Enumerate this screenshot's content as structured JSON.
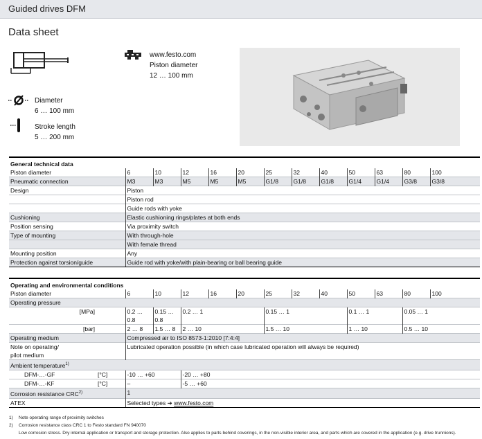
{
  "header": {
    "title": "Guided drives DFM"
  },
  "page_title": "Data sheet",
  "product_data": {
    "website": "www.festo.com",
    "label": "Piston diameter",
    "range": "12 … 100 mm"
  },
  "features": [
    {
      "icon": "diameter-icon",
      "label": "Diameter",
      "value": "6 … 100 mm"
    },
    {
      "icon": "stroke-length-icon",
      "label": "Stroke length",
      "value": "5 … 200 mm"
    }
  ],
  "diameters": [
    "6",
    "10",
    "12",
    "16",
    "20",
    "25",
    "32",
    "40",
    "50",
    "63",
    "80",
    "100"
  ],
  "general": {
    "title": "General technical data",
    "piston_label": "Piston diameter",
    "pneumatic": {
      "label": "Pneumatic connection",
      "values": [
        "M3",
        "M3",
        "M5",
        "M5",
        "M5",
        "G1/8",
        "G1/8",
        "G1/8",
        "G1/4",
        "G1/4",
        "G3/8",
        "G3/8"
      ]
    },
    "design": {
      "label": "Design",
      "values": [
        "Piston",
        "Piston rod",
        "Guide rods with yoke"
      ]
    },
    "cushioning": {
      "label": "Cushioning",
      "value": "Elastic cushioning rings/plates at both ends"
    },
    "position_sensing": {
      "label": "Position sensing",
      "value": "Via proximity switch"
    },
    "mounting": {
      "label": "Type of mounting",
      "values": [
        "With through-hole",
        "With female thread"
      ]
    },
    "mounting_position": {
      "label": "Mounting position",
      "value": "Any"
    },
    "torsion": {
      "label": "Protection against torsion/guide",
      "value": "Guide rod with yoke/with plain-bearing or ball bearing guide"
    }
  },
  "operating": {
    "title": "Operating and environmental conditions",
    "piston_label": "Piston diameter",
    "pressure_label": "Operating pressure",
    "mpa_unit": "[MPa]",
    "bar_unit": "[bar]",
    "mpa": {
      "a1": "0.2 …",
      "a2": "0.8",
      "b1": "0.15 …",
      "b2": "0.8",
      "c": "0.2 … 1",
      "d": "0.15 … 1",
      "e": "0.1 … 1",
      "f": "0.05 … 1"
    },
    "bar": {
      "a": "2 … 8",
      "b": "1.5 … 8",
      "c": "2 … 10",
      "d": "1.5 … 10",
      "e": "1 … 10",
      "f": "0.5 … 10"
    },
    "medium": {
      "label": "Operating medium",
      "value": "Compressed air to ISO 8573-1:2010 [7:4:4]"
    },
    "note": {
      "label1": "Note on operating/",
      "label2": "pilot medium",
      "value": "Lubricated operation possible (in which case lubricated operation will always be required)"
    },
    "ambient": {
      "label": "Ambient temperature",
      "sup": "1)"
    },
    "gf": {
      "label": "DFM-…-GF",
      "unit": "[°C]",
      "v1": "-10 … +60",
      "v2": "-20 … +80"
    },
    "kf": {
      "label": "DFM-…-KF",
      "unit": "[°C]",
      "v1": "–",
      "v2": "-5 … +60"
    },
    "crc": {
      "label": "Corrosion resistance CRC",
      "sup": "2)",
      "value": "1"
    },
    "atex": {
      "label": "ATEX",
      "prefix": "Selected types ➔ ",
      "link": "www.festo.com"
    }
  },
  "footnotes": [
    {
      "num": "1)",
      "text": "Note operating range of proximity switches"
    },
    {
      "num": "2)",
      "text": "Corrosion resistance class CRC 1 to Festo standard FN 940070"
    },
    {
      "num": "",
      "text": "Low corrosion stress. Dry internal application or transport and storage protection. Also applies to parts behind coverings, in the non-visible interior area, and parts which are covered in the application (e.g. drive trunnions)."
    }
  ]
}
